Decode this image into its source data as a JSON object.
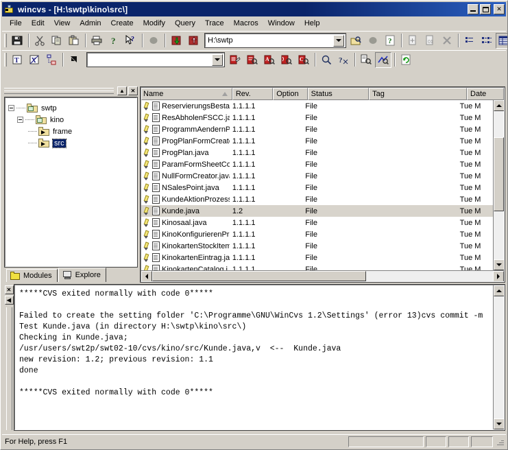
{
  "window": {
    "title": "wincvs - [H:\\swtp\\kino\\src\\]",
    "icon": "wincvs-app-icon",
    "minimize_label": "_",
    "maximize_label": "",
    "close_label": "✕"
  },
  "menubar": {
    "items": [
      {
        "label": "File"
      },
      {
        "label": "Edit"
      },
      {
        "label": "View"
      },
      {
        "label": "Admin"
      },
      {
        "label": "Create"
      },
      {
        "label": "Modify"
      },
      {
        "label": "Query"
      },
      {
        "label": "Trace"
      },
      {
        "label": "Macros"
      },
      {
        "label": "Window"
      },
      {
        "label": "Help"
      }
    ]
  },
  "toolbar_main": {
    "buttons": [
      {
        "name": "save-icon"
      },
      {
        "name": "cut-icon"
      },
      {
        "name": "copy-icon"
      },
      {
        "name": "paste-icon"
      },
      {
        "name": "print-icon"
      },
      {
        "name": "about-help-icon"
      },
      {
        "name": "context-help-icon"
      },
      {
        "name": "stop-icon"
      },
      {
        "name": "checkout-icon"
      },
      {
        "name": "import-icon"
      },
      {
        "name": "browse-folder-icon"
      },
      {
        "name": "stop-process-icon"
      },
      {
        "name": "query-help-icon"
      },
      {
        "name": "add-file-icon"
      },
      {
        "name": "add-binary-icon"
      },
      {
        "name": "remove-icon"
      },
      {
        "name": "list-small-icon"
      },
      {
        "name": "list-large-icon"
      },
      {
        "name": "details-view-icon"
      },
      {
        "name": "preview-icon"
      }
    ],
    "path_value": "H:\\swtp",
    "path_placeholder": ""
  },
  "toolbar_secondary": {
    "buttons": [
      {
        "name": "text-mode-icon"
      },
      {
        "name": "binary-mode-icon"
      },
      {
        "name": "branch-icon"
      },
      {
        "name": "select-arrow-icon"
      },
      {
        "name": "log-icon"
      },
      {
        "name": "log-detail-icon"
      },
      {
        "name": "annotate-icon"
      },
      {
        "name": "status-icon"
      },
      {
        "name": "commit-query-icon"
      },
      {
        "name": "query-update-icon"
      },
      {
        "name": "query-unknown-icon"
      },
      {
        "name": "diff-icon"
      },
      {
        "name": "graph-icon"
      },
      {
        "name": "refresh-icon"
      }
    ],
    "filter_value": "",
    "filter_placeholder": ""
  },
  "tree_panel": {
    "dock_minimize_label": "▲",
    "dock_close_label": "✕",
    "nodes": [
      {
        "label": "swtp",
        "level": 0,
        "expanded": true,
        "selected": false,
        "icon": "cvs-folder-icon"
      },
      {
        "label": "kino",
        "level": 1,
        "expanded": true,
        "selected": false,
        "icon": "cvs-folder-icon"
      },
      {
        "label": "frame",
        "level": 2,
        "expanded": false,
        "selected": false,
        "icon": "folder-icon"
      },
      {
        "label": "src",
        "level": 2,
        "expanded": false,
        "selected": true,
        "icon": "folder-icon"
      }
    ],
    "tabs": [
      {
        "label": "Modules",
        "icon": "folder-icon",
        "active": false
      },
      {
        "label": "Explore",
        "icon": "monitor-icon",
        "active": true
      }
    ]
  },
  "file_list": {
    "columns": [
      {
        "label": "Name",
        "sorted": "asc"
      },
      {
        "label": "Rev.",
        "sorted": ""
      },
      {
        "label": "Option",
        "sorted": ""
      },
      {
        "label": "Status",
        "sorted": ""
      },
      {
        "label": "Tag",
        "sorted": ""
      },
      {
        "label": "Date",
        "sorted": ""
      }
    ],
    "rows": [
      {
        "name": "ReservierungsBesta...",
        "rev": "1.1.1.1",
        "option": "",
        "status": "File",
        "tag": "",
        "date": "Tue M",
        "selected": false
      },
      {
        "name": "ResAbholenFSCC.java",
        "rev": "1.1.1.1",
        "option": "",
        "status": "File",
        "tag": "",
        "date": "Tue M",
        "selected": false
      },
      {
        "name": "ProgrammAendernPr...",
        "rev": "1.1.1.1",
        "option": "",
        "status": "File",
        "tag": "",
        "date": "Tue M",
        "selected": false
      },
      {
        "name": "ProgPlanFormCreato...",
        "rev": "1.1.1.1",
        "option": "",
        "status": "File",
        "tag": "",
        "date": "Tue M",
        "selected": false
      },
      {
        "name": "ProgPlan.java",
        "rev": "1.1.1.1",
        "option": "",
        "status": "File",
        "tag": "",
        "date": "Tue M",
        "selected": false
      },
      {
        "name": "ParamFormSheetCo...",
        "rev": "1.1.1.1",
        "option": "",
        "status": "File",
        "tag": "",
        "date": "Tue M",
        "selected": false
      },
      {
        "name": "NullFormCreator.java",
        "rev": "1.1.1.1",
        "option": "",
        "status": "File",
        "tag": "",
        "date": "Tue M",
        "selected": false
      },
      {
        "name": "NSalesPoint.java",
        "rev": "1.1.1.1",
        "option": "",
        "status": "File",
        "tag": "",
        "date": "Tue M",
        "selected": false
      },
      {
        "name": "KundeAktionProzess...",
        "rev": "1.1.1.1",
        "option": "",
        "status": "File",
        "tag": "",
        "date": "Tue M",
        "selected": false
      },
      {
        "name": "Kunde.java",
        "rev": "1.2",
        "option": "",
        "status": "File",
        "tag": "",
        "date": "Tue M",
        "selected": true
      },
      {
        "name": "Kinosaal.java",
        "rev": "1.1.1.1",
        "option": "",
        "status": "File",
        "tag": "",
        "date": "Tue M",
        "selected": false
      },
      {
        "name": "KinoKonfigurierenPro...",
        "rev": "1.1.1.1",
        "option": "",
        "status": "File",
        "tag": "",
        "date": "Tue M",
        "selected": false
      },
      {
        "name": "KinokartenStockItem...",
        "rev": "1.1.1.1",
        "option": "",
        "status": "File",
        "tag": "",
        "date": "Tue M",
        "selected": false
      },
      {
        "name": "KinokartenEintrag.java",
        "rev": "1.1.1.1",
        "option": "",
        "status": "File",
        "tag": "",
        "date": "Tue M",
        "selected": false
      },
      {
        "name": "KinokartenCatalog.j",
        "rev": "1.1.1.1",
        "option": "",
        "status": "File",
        "tag": "",
        "date": "Tue M",
        "selected": false
      }
    ]
  },
  "console": {
    "dock_close_label": "✕",
    "dock_minimize_label": "◀",
    "text": "*****CVS exited normally with code 0*****\n\nFailed to create the setting folder 'C:\\Programme\\GNU\\WinCvs 1.2\\Settings' (error 13)cvs commit -m Test Kunde.java (in directory H:\\swtp\\kino\\src\\)\nChecking in Kunde.java;\n/usr/users/swt2p/swt02-10/cvs/kino/src/Kunde.java,v  <--  Kunde.java\nnew revision: 1.2; previous revision: 1.1\ndone\n\n*****CVS exited normally with code 0*****"
  },
  "statusbar": {
    "text": "For Help, press F1",
    "panes": [
      "",
      "",
      "",
      ""
    ]
  },
  "colors": {
    "title_active": "#0a246a",
    "face": "#d4d0c8",
    "selection": "#0a246a",
    "row_selected": "#d8d4cc",
    "folder": "#f0e0a0"
  }
}
